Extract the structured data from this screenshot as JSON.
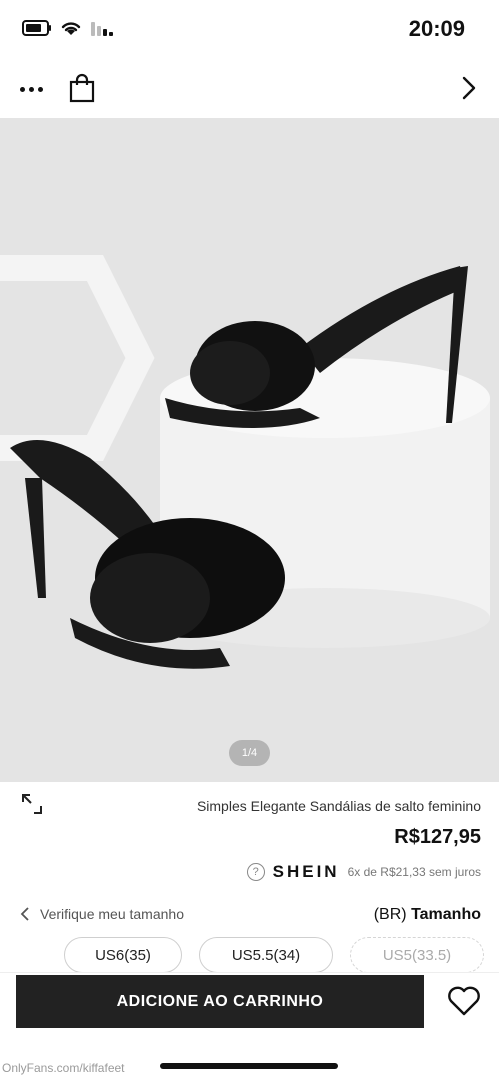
{
  "status_bar": {
    "time": "20:09"
  },
  "nav": {
    "more_icon": "more-dots-icon",
    "bag_icon": "shopping-bag-icon",
    "next_icon": "chevron-right-icon"
  },
  "gallery": {
    "counter": "1/4",
    "background": "#e4e4e4"
  },
  "product": {
    "title": "Simples Elegante Sandálias de salto feminino",
    "price": "R$127,95",
    "installment": "6x de R$21,33 sem juros",
    "brand": "SHEIN",
    "help_glyph": "?"
  },
  "size": {
    "label_prefix": "Tamanho",
    "label_region": "(BR)",
    "guide_link": "Verifique meu tamanho",
    "options": [
      {
        "label": "US5(33.5)",
        "available": false
      },
      {
        "label": "US5.5(34)",
        "available": true
      },
      {
        "label": "US6(35)",
        "available": true
      }
    ]
  },
  "actions": {
    "add_to_cart": "ADICIONE AO CARRINHO",
    "wishlist_icon": "heart-icon"
  },
  "watermark": "OnlyFans.com/kiffafeet",
  "colors": {
    "button_bg": "#222222",
    "text_primary": "#111111",
    "text_muted": "#777777"
  }
}
